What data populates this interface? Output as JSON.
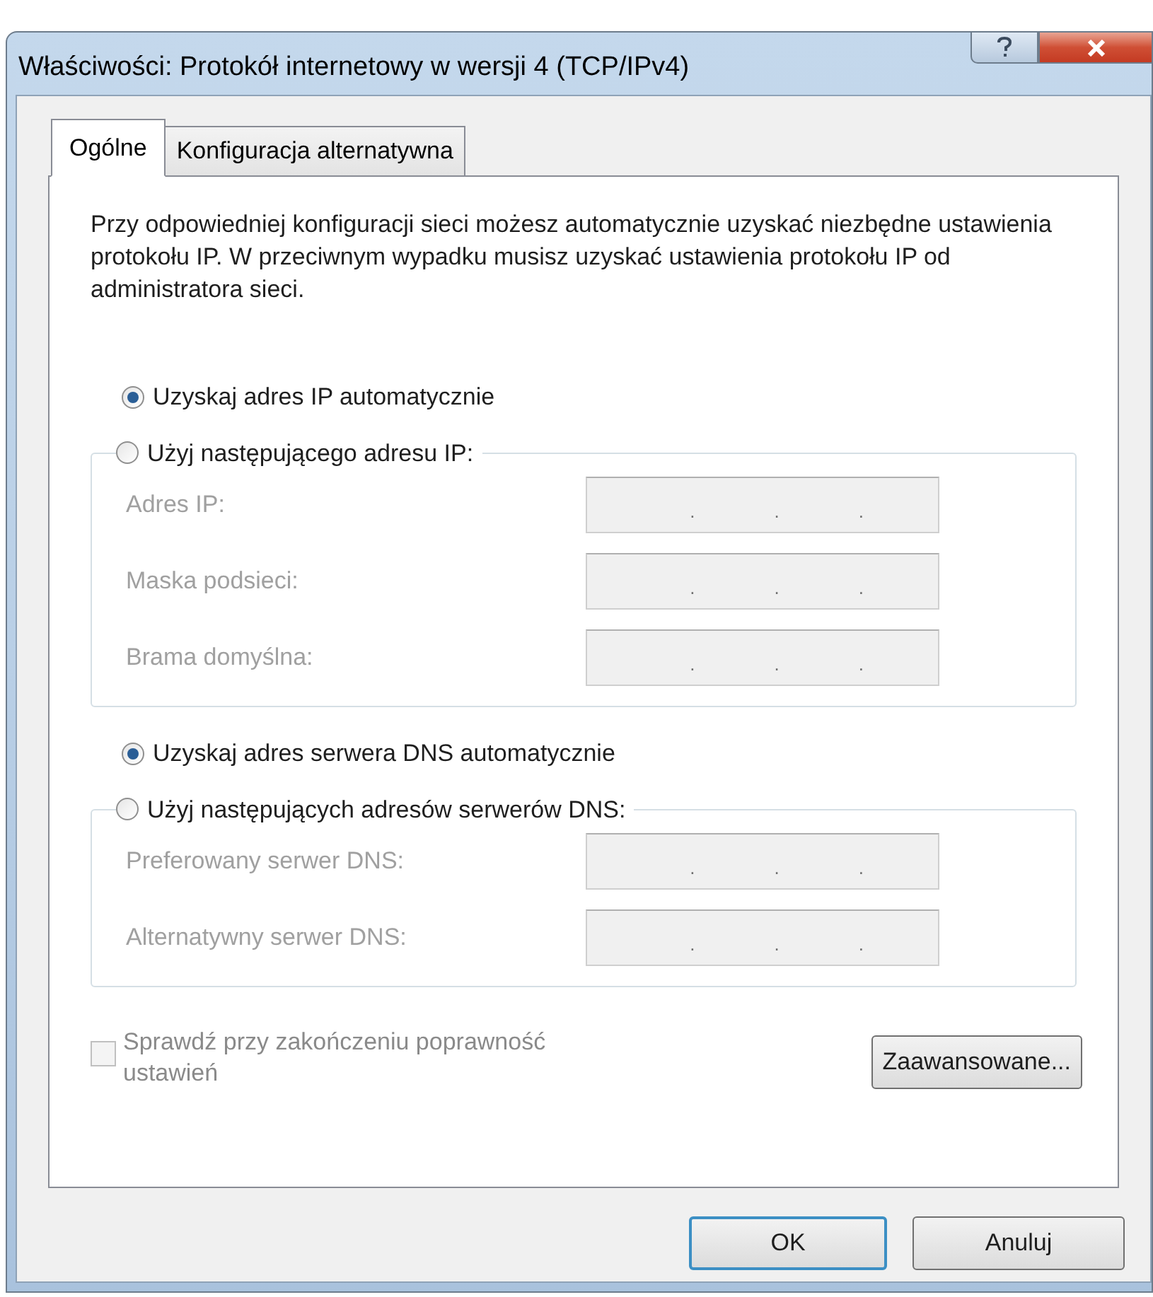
{
  "window": {
    "title": "Właściwości: Protokół internetowy w wersji 4 (TCP/IPv4)"
  },
  "tabs": [
    {
      "label": "Ogólne",
      "selected": true
    },
    {
      "label": "Konfiguracja alternatywna",
      "selected": false
    }
  ],
  "description": "Przy odpowiedniej konfiguracji sieci możesz automatycznie uzyskać niezbędne ustawienia protokołu IP. W przeciwnym wypadku musisz uzyskać ustawienia protokołu IP od administratora sieci.",
  "ip_options": [
    {
      "label": "Uzyskaj adres IP automatycznie",
      "selected": true
    },
    {
      "label": "Użyj następującego adresu IP:",
      "selected": false
    }
  ],
  "ip_fields": [
    {
      "label": "Adres IP:",
      "separators": [
        ".",
        ".",
        "."
      ],
      "disabled": true
    },
    {
      "label": "Maska podsieci:",
      "separators": [
        ".",
        ".",
        "."
      ],
      "disabled": true
    },
    {
      "label": "Brama domyślna:",
      "separators": [
        ".",
        ".",
        "."
      ],
      "disabled": true
    }
  ],
  "dns_options": [
    {
      "label": "Uzyskaj adres serwera DNS automatycznie",
      "selected": true
    },
    {
      "label": "Użyj następujących adresów serwerów DNS:",
      "selected": false
    }
  ],
  "dns_fields": [
    {
      "label": "Preferowany serwer DNS:",
      "separators": [
        ".",
        ".",
        "."
      ],
      "disabled": true
    },
    {
      "label": "Alternatywny serwer DNS:",
      "separators": [
        ".",
        ".",
        "."
      ],
      "disabled": true
    }
  ],
  "validate_checkbox": {
    "label": "Sprawdź przy zakończeniu poprawność ustawień",
    "checked": false,
    "disabled": true
  },
  "advanced_button": "Zaawansowane...",
  "buttons": [
    {
      "label": "OK",
      "default": true
    },
    {
      "label": "Anuluj",
      "default": false
    }
  ]
}
